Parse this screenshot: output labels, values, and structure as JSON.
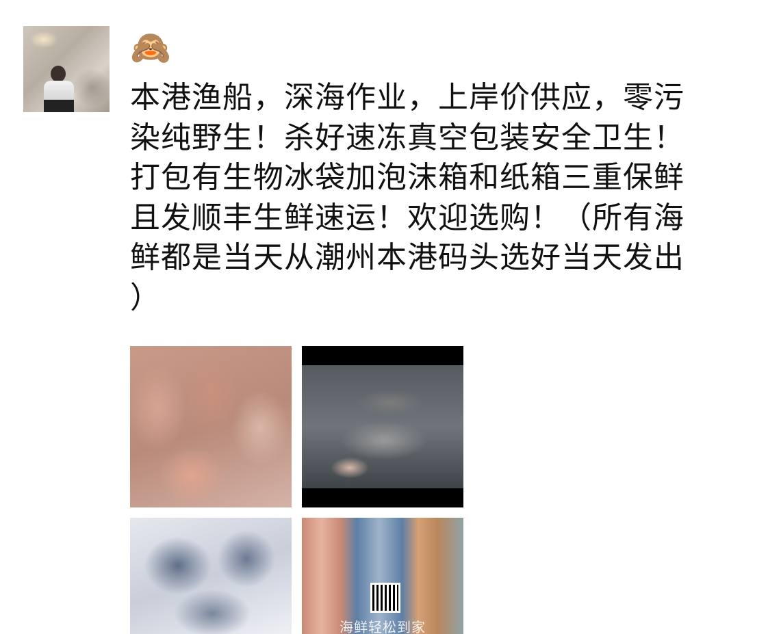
{
  "post": {
    "emoji": "🙈",
    "text": "本港渔船，深海作业，上岸价供应，零污染纯野生！杀好速冻真空包装安全卫生！打包有生物冰袋加泡沫箱和纸箱三重保鲜且发顺丰生鲜速运！欢迎选购！（所有海鲜都是当天从潮州本港码头选好当天发出）",
    "lines": [
      "本港渔船，深海作业，上岸价供应，零污",
      "染纯野生！杀好速冻真空包装安全卫生！",
      "打包有生物冰袋加泡沫箱和纸箱三重保鲜",
      "且发顺丰生鲜速运！欢迎选购！（所有海",
      "鲜都是当天从潮州本港码头选好当天发出",
      "）"
    ]
  },
  "images": [
    {
      "name": "red-fish-photo"
    },
    {
      "name": "spotted-pufferfish-photo"
    },
    {
      "name": "frozen-fish-photo"
    },
    {
      "name": "seafood-collage-photo",
      "caption": "海鲜轻松到家"
    }
  ]
}
